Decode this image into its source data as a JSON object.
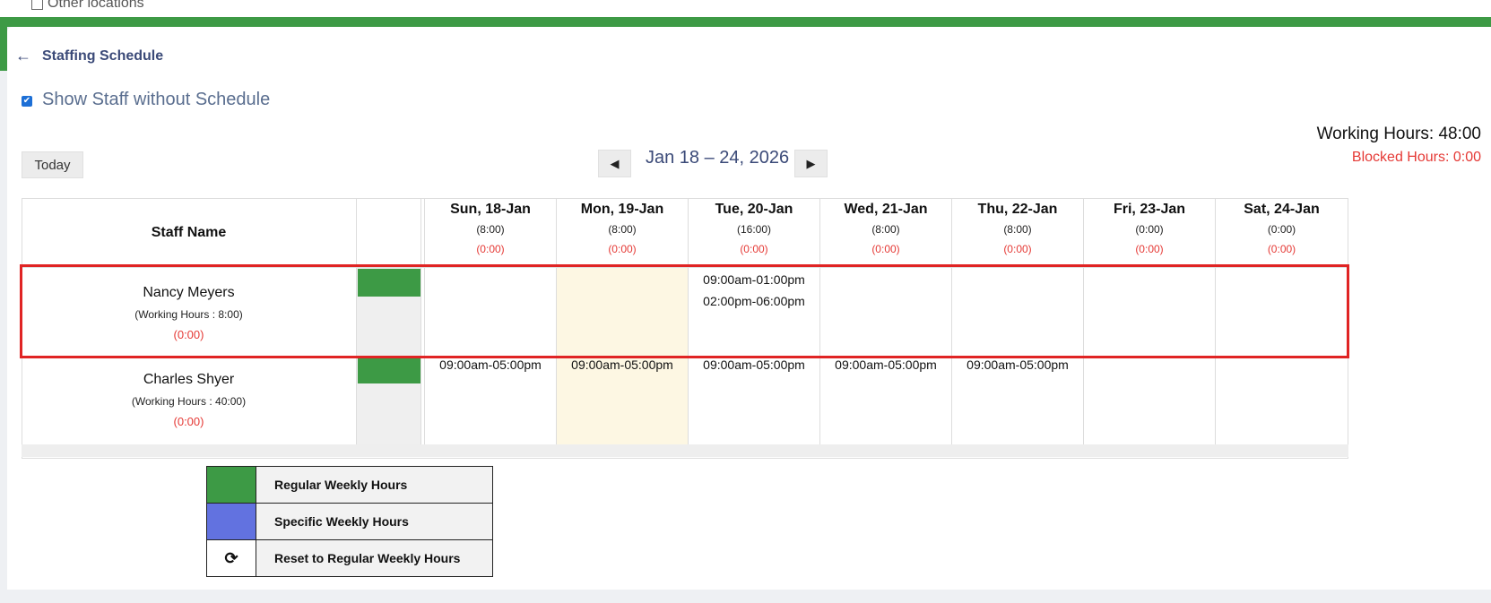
{
  "top": {
    "other_locations": "Other locations"
  },
  "header": {
    "back_icon": "←",
    "title": "Staffing Schedule"
  },
  "options": {
    "show_staff_without_schedule": "Show Staff without Schedule",
    "checked": true
  },
  "toolbar": {
    "today": "Today",
    "prev": "◀",
    "next": "▶",
    "range": "Jan 18 – 24, 2026"
  },
  "summary": {
    "working_hours": "Working Hours: 48:00",
    "blocked_hours": "Blocked Hours: 0:00"
  },
  "table": {
    "staff_header": "Staff Name",
    "days": [
      {
        "label": "Sun, 18-Jan",
        "hours": "(8:00)",
        "blocked": "(0:00)"
      },
      {
        "label": "Mon, 19-Jan",
        "hours": "(8:00)",
        "blocked": "(0:00)"
      },
      {
        "label": "Tue, 20-Jan",
        "hours": "(16:00)",
        "blocked": "(0:00)"
      },
      {
        "label": "Wed, 21-Jan",
        "hours": "(8:00)",
        "blocked": "(0:00)"
      },
      {
        "label": "Thu, 22-Jan",
        "hours": "(8:00)",
        "blocked": "(0:00)"
      },
      {
        "label": "Fri, 23-Jan",
        "hours": "(0:00)",
        "blocked": "(0:00)"
      },
      {
        "label": "Sat, 24-Jan",
        "hours": "(0:00)",
        "blocked": "(0:00)"
      }
    ],
    "rows": [
      {
        "name": "Nancy Meyers",
        "working": "(Working Hours : 8:00)",
        "blocked": "(0:00)",
        "shifts": [
          "",
          "",
          "09:00am-01:00pm",
          "",
          "",
          "",
          ""
        ],
        "shifts2": [
          "",
          "",
          "02:00pm-06:00pm",
          "",
          "",
          "",
          ""
        ]
      },
      {
        "name": "Charles Shyer",
        "working": "(Working Hours : 40:00)",
        "blocked": "(0:00)",
        "shifts": [
          "09:00am-05:00pm",
          "09:00am-05:00pm",
          "09:00am-05:00pm",
          "09:00am-05:00pm",
          "09:00am-05:00pm",
          "",
          ""
        ]
      }
    ]
  },
  "legend": {
    "regular": "Regular Weekly Hours",
    "specific": "Specific Weekly Hours",
    "reset": "Reset to Regular Weekly Hours",
    "reset_icon": "⟳",
    "colors": {
      "regular": "#3d9a45",
      "specific": "#6272e0"
    }
  },
  "colors": {
    "accent_green": "#3d9a45",
    "blocked_red": "#e53935",
    "highlight_red": "#e02424",
    "title_navy": "#3b4a78"
  }
}
